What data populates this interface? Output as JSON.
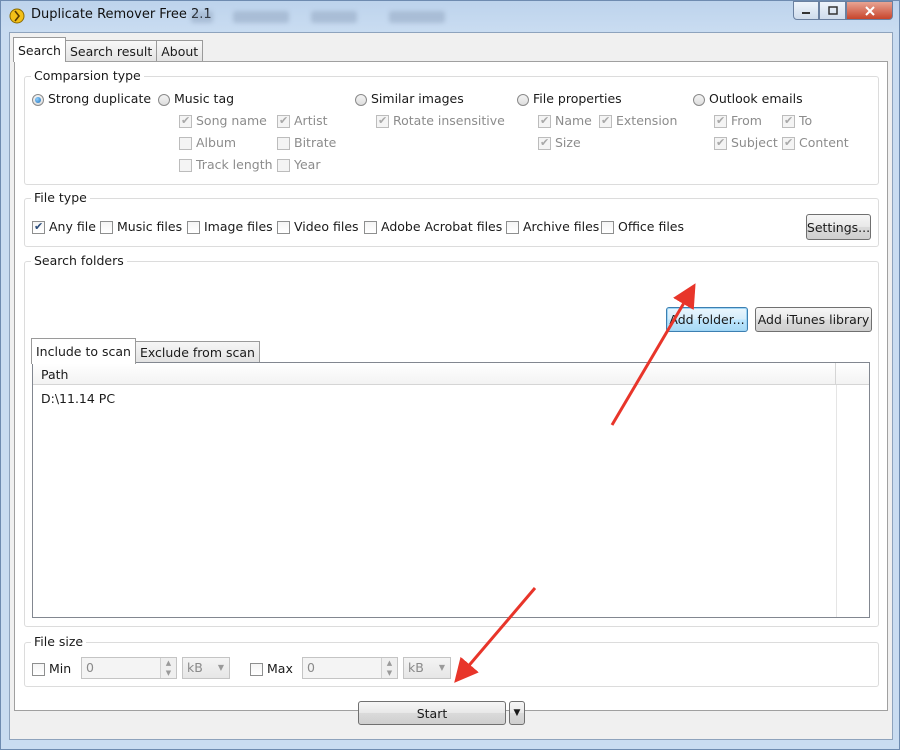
{
  "window": {
    "title": "Duplicate Remover Free 2.1"
  },
  "tabs": [
    "Search",
    "Search result",
    "About"
  ],
  "comparison": {
    "title": "Comparsion type",
    "strong_duplicate": "Strong duplicate",
    "music_tag": "Music tag",
    "similar_images": "Similar images",
    "file_properties": "File properties",
    "outlook_emails": "Outlook emails",
    "music_options": [
      "Song name",
      "Artist",
      "Album",
      "Bitrate",
      "Track length",
      "Year"
    ],
    "image_options": [
      "Rotate insensitive"
    ],
    "file_options": [
      "Name",
      "Extension",
      "Size"
    ],
    "outlook_options": [
      "From",
      "To",
      "Subject",
      "Content"
    ]
  },
  "file_type": {
    "title": "File type",
    "options": [
      "Any file",
      "Music files",
      "Image files",
      "Video files",
      "Adobe Acrobat files",
      "Archive files",
      "Office files"
    ],
    "settings_button": "Settings..."
  },
  "search_folders": {
    "title": "Search folders",
    "add_folder": "Add folder...",
    "add_itunes": "Add iTunes library",
    "tabs": [
      "Include to scan",
      "Exclude from scan"
    ],
    "column_path": "Path",
    "rows": [
      "D:\\11.14 PC"
    ]
  },
  "file_size": {
    "title": "File size",
    "min_label": "Min",
    "max_label": "Max",
    "min_value": "0",
    "max_value": "0",
    "min_unit": "kB",
    "max_unit": "kB"
  },
  "start_button": "Start",
  "colors": {
    "annotation_arrow": "#e8352a",
    "focus_border": "#3c7fb1"
  }
}
